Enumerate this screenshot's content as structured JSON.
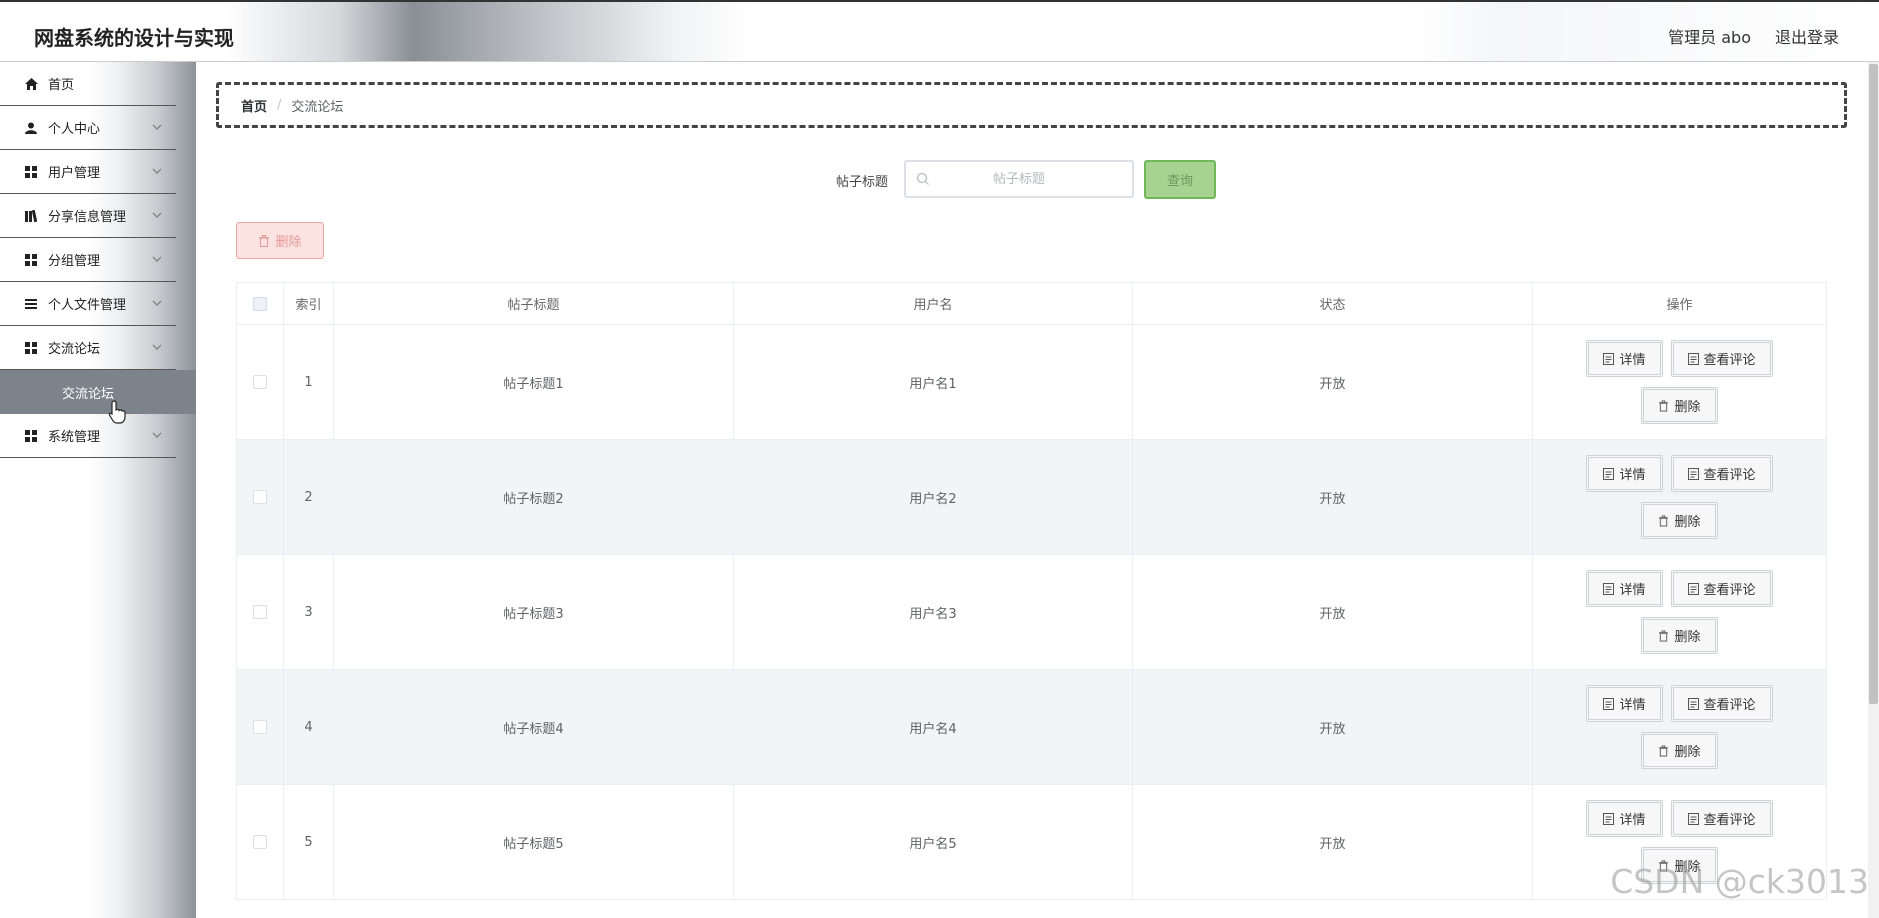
{
  "app": {
    "title": "网盘系统的设计与实现"
  },
  "header": {
    "admin_label": "管理员 abo",
    "logout_label": "退出登录"
  },
  "sidebar": {
    "items": [
      {
        "label": "首页",
        "icon": "home-icon"
      },
      {
        "label": "个人中心",
        "icon": "user-icon"
      },
      {
        "label": "用户管理",
        "icon": "grid-icon"
      },
      {
        "label": "分享信息管理",
        "icon": "books-icon"
      },
      {
        "label": "分组管理",
        "icon": "grid-icon"
      },
      {
        "label": "个人文件管理",
        "icon": "list-icon"
      },
      {
        "label": "交流论坛",
        "icon": "grid-icon"
      },
      {
        "label": "系统管理",
        "icon": "grid-icon"
      }
    ],
    "active_submenu": "交流论坛"
  },
  "breadcrumb": {
    "home": "首页",
    "separator": "/",
    "current": "交流论坛"
  },
  "search": {
    "label": "帖子标题",
    "placeholder": "帖子标题",
    "button": "查询"
  },
  "actions": {
    "delete": "删除"
  },
  "table": {
    "columns": [
      "索引",
      "帖子标题",
      "用户名",
      "状态",
      "操作"
    ],
    "rows": [
      {
        "index": "1",
        "title": "帖子标题1",
        "user": "用户名1",
        "status": "开放"
      },
      {
        "index": "2",
        "title": "帖子标题2",
        "user": "用户名2",
        "status": "开放"
      },
      {
        "index": "3",
        "title": "帖子标题3",
        "user": "用户名3",
        "status": "开放"
      },
      {
        "index": "4",
        "title": "帖子标题4",
        "user": "用户名4",
        "status": "开放"
      },
      {
        "index": "5",
        "title": "帖子标题5",
        "user": "用户名5",
        "status": "开放"
      }
    ],
    "row_actions": {
      "detail": "详情",
      "comments": "查看评论",
      "delete": "删除"
    }
  },
  "watermark": "CSDN @ck3013"
}
